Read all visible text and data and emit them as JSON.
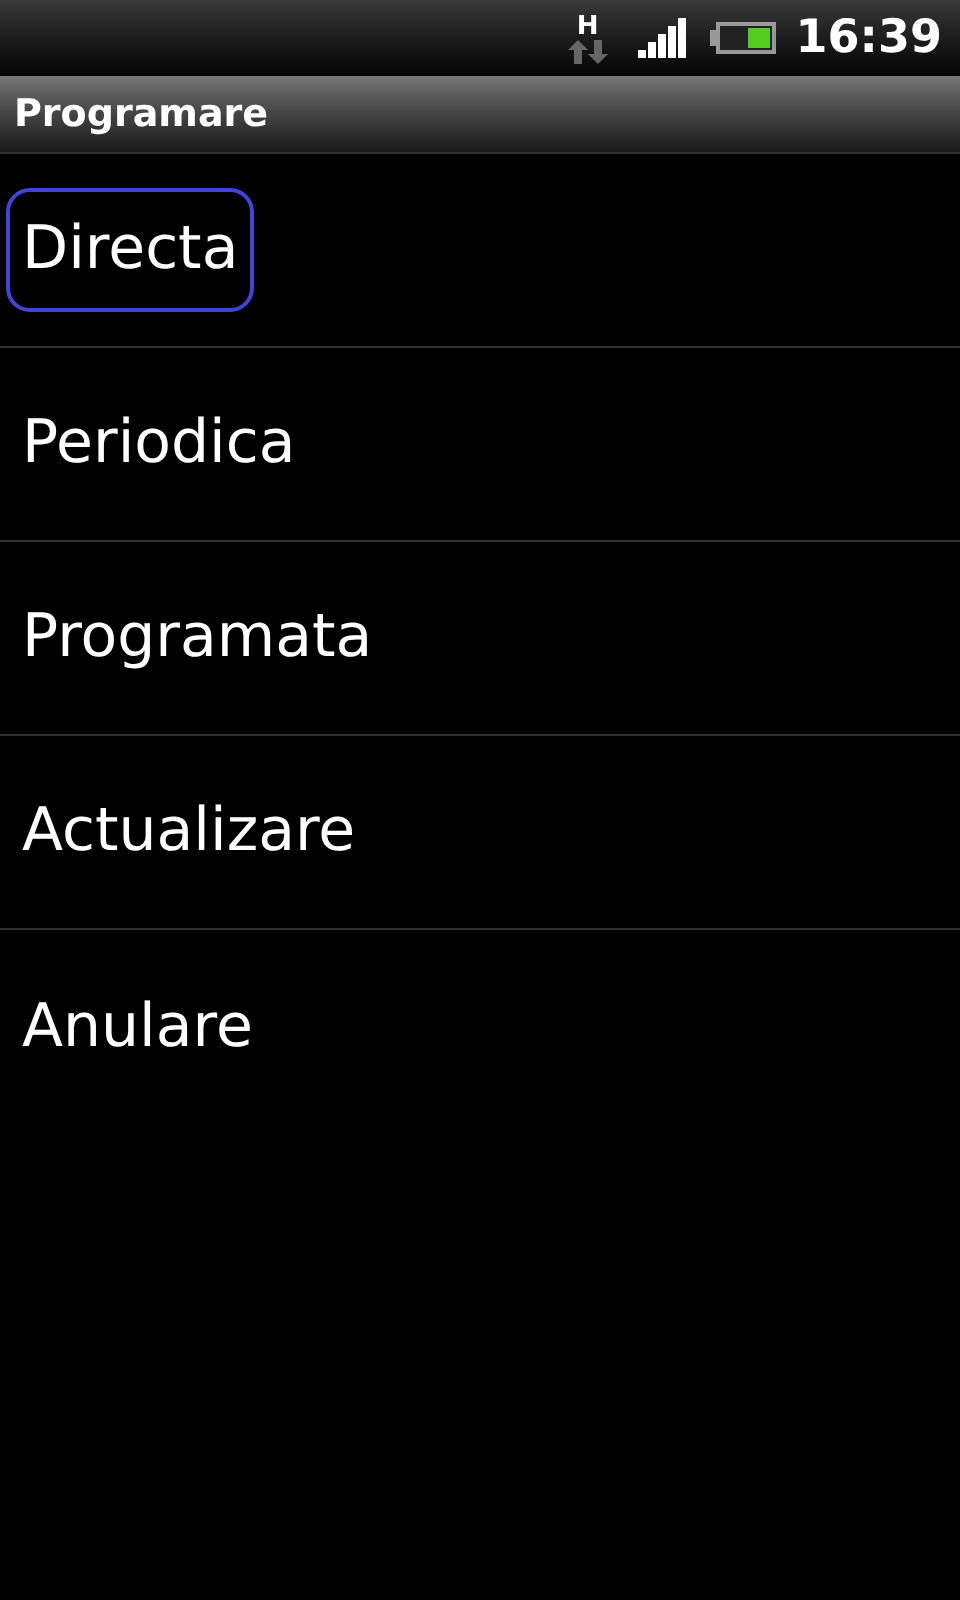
{
  "status_bar": {
    "network": "H",
    "time": "16:39"
  },
  "title_bar": {
    "title": "Programare"
  },
  "menu": {
    "items": [
      {
        "label": "Directa",
        "selected": true
      },
      {
        "label": "Periodica",
        "selected": false
      },
      {
        "label": "Programata",
        "selected": false
      },
      {
        "label": "Actualizare",
        "selected": false
      },
      {
        "label": "Anulare",
        "selected": false
      }
    ]
  }
}
